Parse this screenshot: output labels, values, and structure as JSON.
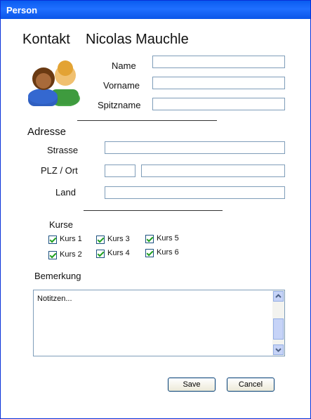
{
  "window": {
    "title": "Person"
  },
  "header": {
    "label": "Kontakt",
    "name": "Nicolas Mauchle"
  },
  "icons": {
    "contacts": "users-icon"
  },
  "form": {
    "name_label": "Name",
    "vorname_label": "Vorname",
    "spitzname_label": "Spitzname",
    "address_heading": "Adresse",
    "strasse_label": "Strasse",
    "plzort_label": "PLZ / Ort",
    "land_label": "Land"
  },
  "courses": {
    "heading": "Kurse",
    "items": [
      {
        "label": "Kurs 1",
        "checked": true
      },
      {
        "label": "Kurs 2",
        "checked": true
      },
      {
        "label": "Kurs 3",
        "checked": true
      },
      {
        "label": "Kurs 4",
        "checked": true
      },
      {
        "label": "Kurs 5",
        "checked": true
      },
      {
        "label": "Kurs 6",
        "checked": true
      }
    ]
  },
  "remarks": {
    "heading": "Bemerkung",
    "text": "Notitzen..."
  },
  "buttons": {
    "save": "Save",
    "cancel": "Cancel"
  },
  "colors": {
    "titlebar": "#0a5cf0",
    "input_border": "#7f9db9",
    "check": "#21a121"
  }
}
